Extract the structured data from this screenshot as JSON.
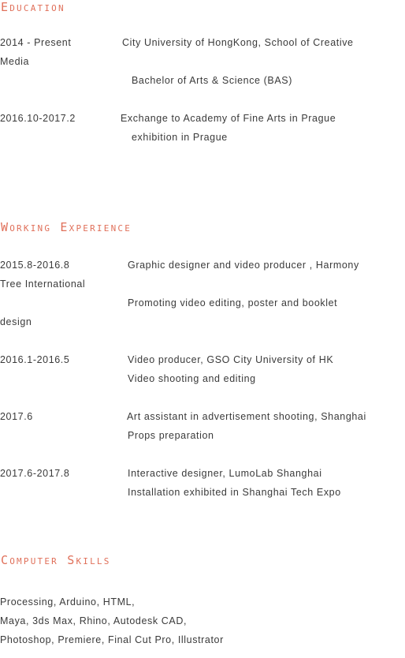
{
  "accent_color": "#e0705a",
  "education": {
    "heading": "Education",
    "entries": [
      {
        "date": "2014 - Present",
        "line1": "City University of HongKong, School of Creative",
        "line1_wrap": "Media",
        "line2": "Bachelor of Arts & Science (BAS)"
      },
      {
        "date": "2016.10-2017.2",
        "line1": "Exchange to Academy of Fine Arts in Prague",
        "line2": "exhibition in Prague"
      }
    ]
  },
  "work": {
    "heading": "Working Experience",
    "entries": [
      {
        "date": "2015.8-2016.8",
        "line1": "Graphic designer and video producer , Harmony",
        "line1_wrap": "Tree International",
        "line2": "Promoting video editing, poster and booklet",
        "line2_wrap": "design"
      },
      {
        "date": "2016.1-2016.5",
        "line1": "Video producer, GSO City University of HK",
        "line2": "Video shooting and editing"
      },
      {
        "date": "2017.6",
        "line1": "Art assistant in advertisement shooting, Shanghai",
        "line2": "Props preparation"
      },
      {
        "date": "2017.6-2017.8",
        "line1": "Interactive designer, LumoLab Shanghai",
        "line2": "Installation exhibited in Shanghai Tech Expo"
      }
    ]
  },
  "skills": {
    "heading": "Computer Skills",
    "lines": [
      "Processing, Arduino, HTML,",
      "Maya, 3ds Max, Rhino, Autodesk CAD,",
      "Photoshop, Premiere, Final Cut Pro, Illustrator"
    ]
  }
}
